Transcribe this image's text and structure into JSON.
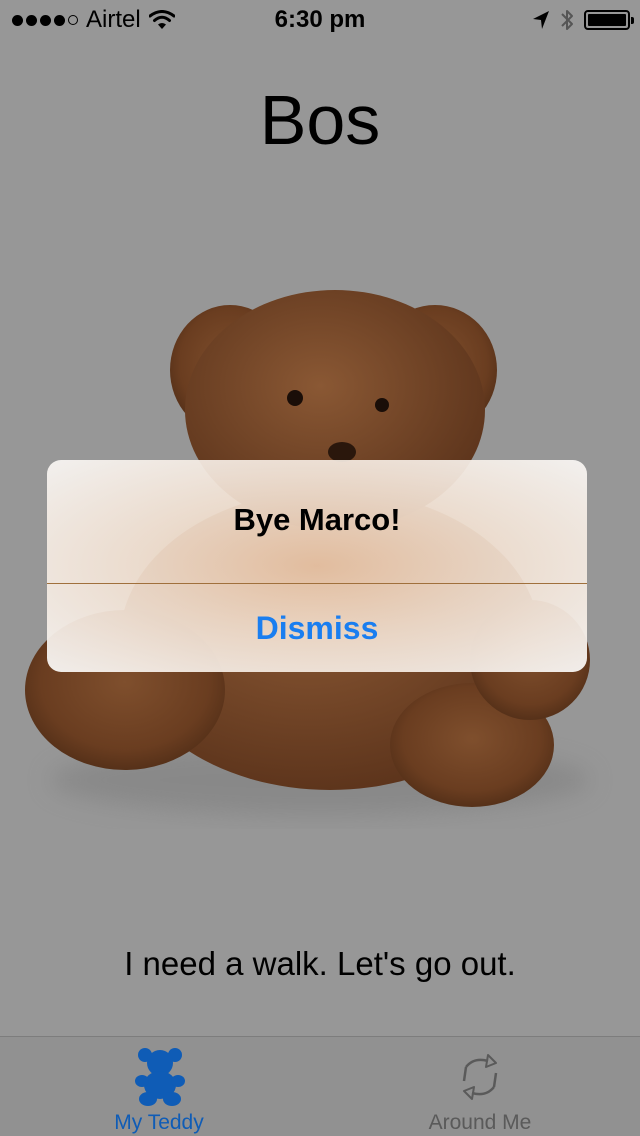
{
  "status_bar": {
    "carrier": "Airtel",
    "signal_bars": 4,
    "time": "6:30 pm",
    "battery_level": 1.0
  },
  "pet": {
    "name": "Bos",
    "message": "I need a walk. Let's go out."
  },
  "alert": {
    "title": "Bye Marco!",
    "button_label": "Dismiss",
    "button_color": "#1a7ef0"
  },
  "tab_bar": {
    "items": [
      {
        "label": "My Teddy",
        "icon": "teddy-bear-icon",
        "selected": true,
        "color": "#0f5cb6"
      },
      {
        "label": "Around Me",
        "icon": "refresh-arrows-icon",
        "selected": false,
        "color": "#5a5a5a"
      }
    ]
  },
  "colors": {
    "background_dim": "#979797",
    "teddy_fur": "#7a4a2a"
  }
}
